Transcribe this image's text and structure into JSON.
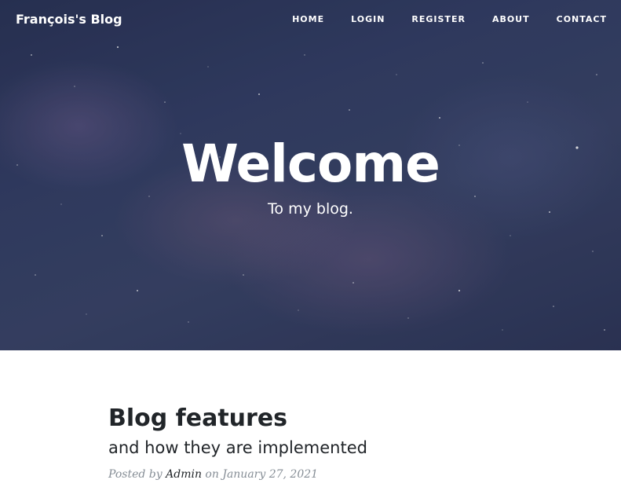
{
  "nav": {
    "brand": "François's Blog",
    "links": [
      "HOME",
      "LOGIN",
      "REGISTER",
      "ABOUT",
      "CONTACT"
    ]
  },
  "hero": {
    "title": "Welcome",
    "subtitle": "To my blog."
  },
  "post": {
    "title": "Blog features",
    "subtitle": "and how they are implemented",
    "posted_by_label": "Posted by",
    "author": "Admin",
    "on_label": "on",
    "date": "January 27, 2021"
  },
  "colors": {
    "text_dark": "#212529",
    "meta_gray": "#868e96",
    "hero_sky": "#343f66"
  }
}
